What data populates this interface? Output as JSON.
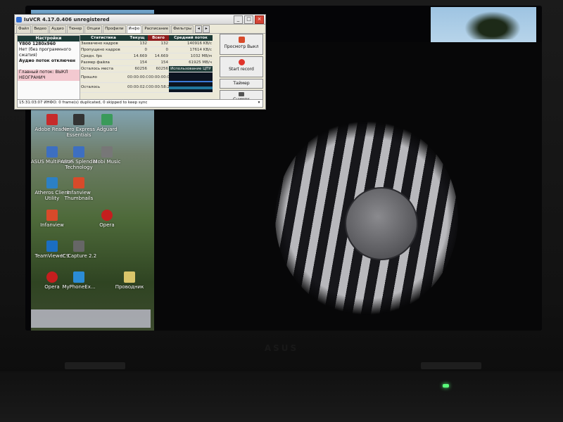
{
  "window": {
    "title": "IuVCR 4.17.0.406 unregistered",
    "tabs": [
      "Файл",
      "Видео",
      "Аудио",
      "Тюнер",
      "Опции",
      "Профили",
      "Инфо",
      "Расписание",
      "Фильтры"
    ],
    "active_tab": "Инфо",
    "settings_panel": {
      "header": "Настройки",
      "rows": [
        "Y800 1280x960",
        "Нет (без программного",
        "сжатия)",
        "Аудио поток отключен",
        "",
        "Главный поток: ВЫКЛ",
        "НЕОГРАНИЧ"
      ]
    },
    "stats": {
      "headers": [
        "Статистика",
        "Текущ",
        "Всего",
        "Средний поток"
      ],
      "rows": [
        {
          "label": "Захвачено кадров",
          "current": "132",
          "total": "132",
          "avg": "140916 KB/с"
        },
        {
          "label": "Пропущено кадров",
          "current": "0",
          "total": "0",
          "avg": "17614 KB/с"
        },
        {
          "label": "Средн. fps",
          "current": "14.669",
          "total": "14.669",
          "avg": "1032 MB/м"
        },
        {
          "label": "Размер файла",
          "current": "154",
          "total": "154",
          "avg": "61925 MB/ч"
        },
        {
          "label": "Осталось места",
          "current": "60256",
          "total": "60256",
          "avg": "Использование ЦПУ"
        },
        {
          "label": "Прошло",
          "current": "00:00:00:09",
          "total": "00:00:00:09",
          "avg": ""
        },
        {
          "label": "Осталось",
          "current": "00:00:02:00",
          "total": "00:00:58:22",
          "avg": ""
        }
      ]
    },
    "buttons": {
      "preview": "Просмотр Выкл",
      "start_record": "Start record",
      "timer": "Таймер",
      "snapshot": "Снимок"
    },
    "status": "15:31:03:07 ИНФО: 0 frame(s) duplicated, 0 skipped to keep sync"
  },
  "desktop_icons": [
    "Adobe Reader",
    "Nero Express Essentials",
    "Adguard",
    "ASUS MultiFrame",
    "ASUS Splendid Technology",
    "Mobi Music",
    "Atheros Client Utility",
    "Infanview Thumbnails",
    "Infanview",
    "Opera",
    "TeamViewer 9",
    "IC Capture 2.2",
    "Opera",
    "MyPhoneEx...",
    "Проводник"
  ],
  "laptop": {
    "brand_logo": "ASUS"
  }
}
